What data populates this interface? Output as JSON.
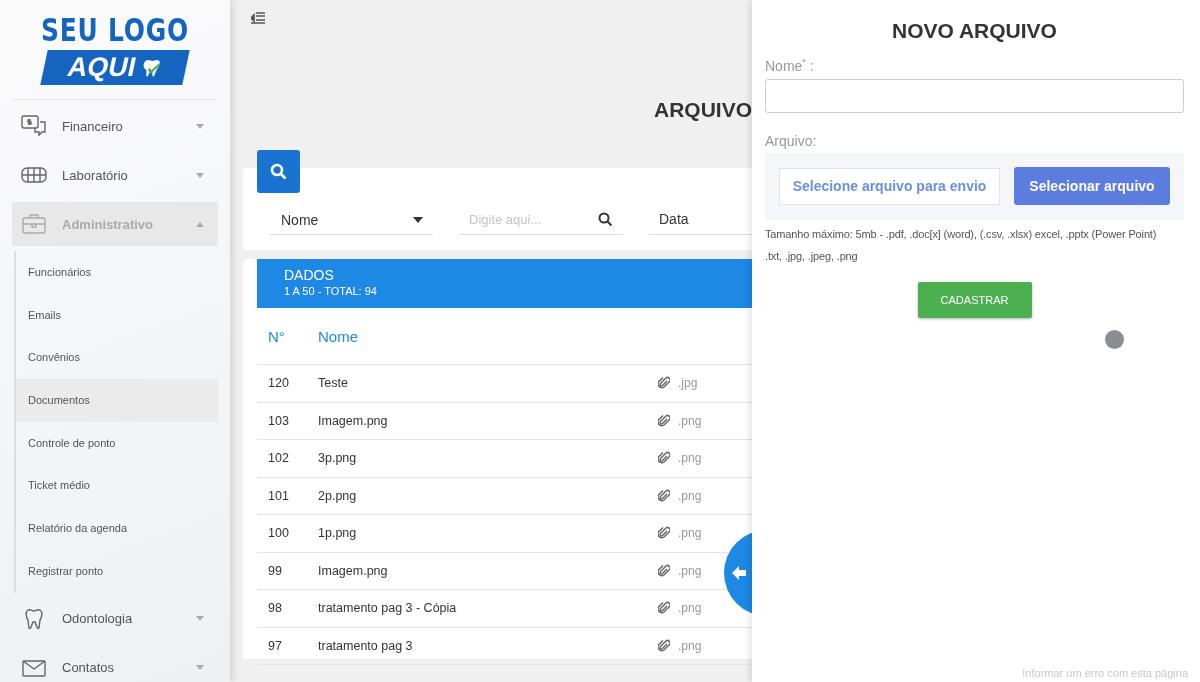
{
  "logo": {
    "line1": "SEU LOGO",
    "line2": "AQUI"
  },
  "menu": [
    {
      "label": "Financeiro",
      "expanded": false
    },
    {
      "label": "Laboratório",
      "expanded": false
    },
    {
      "label": "Administrativo",
      "expanded": true,
      "children": [
        {
          "label": "Funcionários",
          "selected": false
        },
        {
          "label": "Emails",
          "selected": false
        },
        {
          "label": "Convênios",
          "selected": false
        },
        {
          "label": "Documentos",
          "selected": true
        },
        {
          "label": "Controle de ponto",
          "selected": false
        },
        {
          "label": "Ticket médio",
          "selected": false
        },
        {
          "label": "Relatório da agenda",
          "selected": false
        },
        {
          "label": "Registrar ponto",
          "selected": false
        }
      ]
    },
    {
      "label": "Odontologia",
      "expanded": false
    },
    {
      "label": "Contatos",
      "expanded": false
    }
  ],
  "page_title": "ARQUIVO",
  "filters": {
    "field": "Nome",
    "search": {
      "placeholder": "Digite aqui..."
    },
    "date": "Data"
  },
  "data_header": {
    "title": "DADOS",
    "range": "1 A 50 - TOTAL: 94"
  },
  "table": {
    "columns": [
      "N°",
      "Nome"
    ],
    "rows": [
      {
        "num": "120",
        "name": "Teste",
        "ext": ".jpg"
      },
      {
        "num": "103",
        "name": "Imagem.png",
        "ext": ".png"
      },
      {
        "num": "102",
        "name": "3p.png",
        "ext": ".png"
      },
      {
        "num": "101",
        "name": "2p.png",
        "ext": ".png"
      },
      {
        "num": "100",
        "name": "1p.png",
        "ext": ".png"
      },
      {
        "num": "99",
        "name": "Imagem.png",
        "ext": ".png"
      },
      {
        "num": "98",
        "name": "tratamento pag 3 - Cópia",
        "ext": ".png"
      },
      {
        "num": "97",
        "name": "tratamento pag 3",
        "ext": ".png"
      }
    ]
  },
  "drawer": {
    "title": "NOVO ARQUIVO",
    "name_label": "Nome$^{*}$ :",
    "file_label": "Arquivo:",
    "file_placeholder": "Selecione arquivo para envio",
    "select_button": "Selecionar arquivo",
    "help": [
      "Tamanho máximo: 5mb - .pdf, .doc[x] (word), (.csv, .xlsx) excel, .pptx (Power Point)",
      ".txt, .jpg, .jpeg, .png"
    ],
    "submit": "CADASTRAR",
    "report_link": "Informar um erro com esta página"
  }
}
